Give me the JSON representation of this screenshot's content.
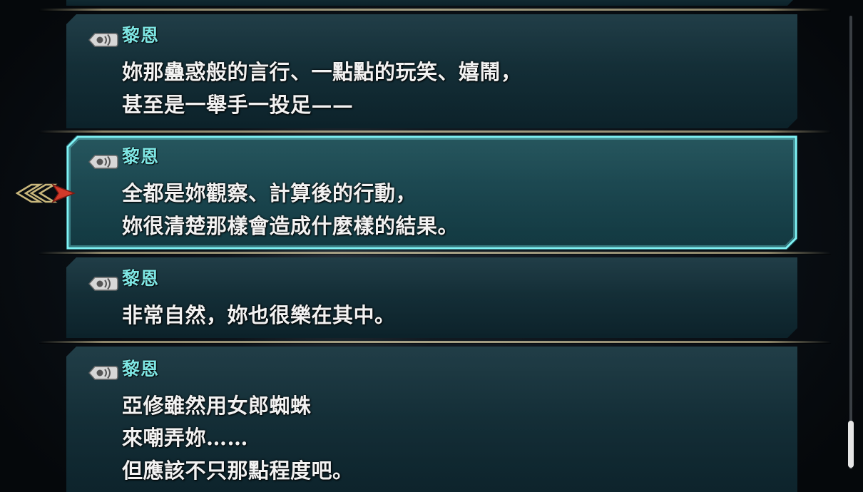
{
  "entries": [
    {
      "speaker": "黎恩",
      "lines": [
        "妳那蠱惑般的言行、一點點的玩笑、嬉鬧，",
        "甚至是一舉手一投足——"
      ],
      "selected": false
    },
    {
      "speaker": "黎恩",
      "lines": [
        "全都是妳觀察、計算後的行動，",
        "妳很清楚那樣會造成什麼樣的結果。"
      ],
      "selected": true
    },
    {
      "speaker": "黎恩",
      "lines": [
        "非常自然，妳也很樂在其中。"
      ],
      "selected": false
    },
    {
      "speaker": "黎恩",
      "lines": [
        "亞修雖然用女郎蜘蛛",
        "來嘲弄妳……",
        "但應該不只那點程度吧。"
      ],
      "selected": false
    }
  ],
  "icons": {
    "voice": "voice-replay-icon",
    "cursor": "selection-cursor-icon"
  },
  "colors": {
    "speaker": "#7ee6e4",
    "text": "#f2f2f2",
    "selected_border": "#7ff3f5",
    "divider": "#d8cea7"
  },
  "scroll": {
    "position": 1.0
  }
}
